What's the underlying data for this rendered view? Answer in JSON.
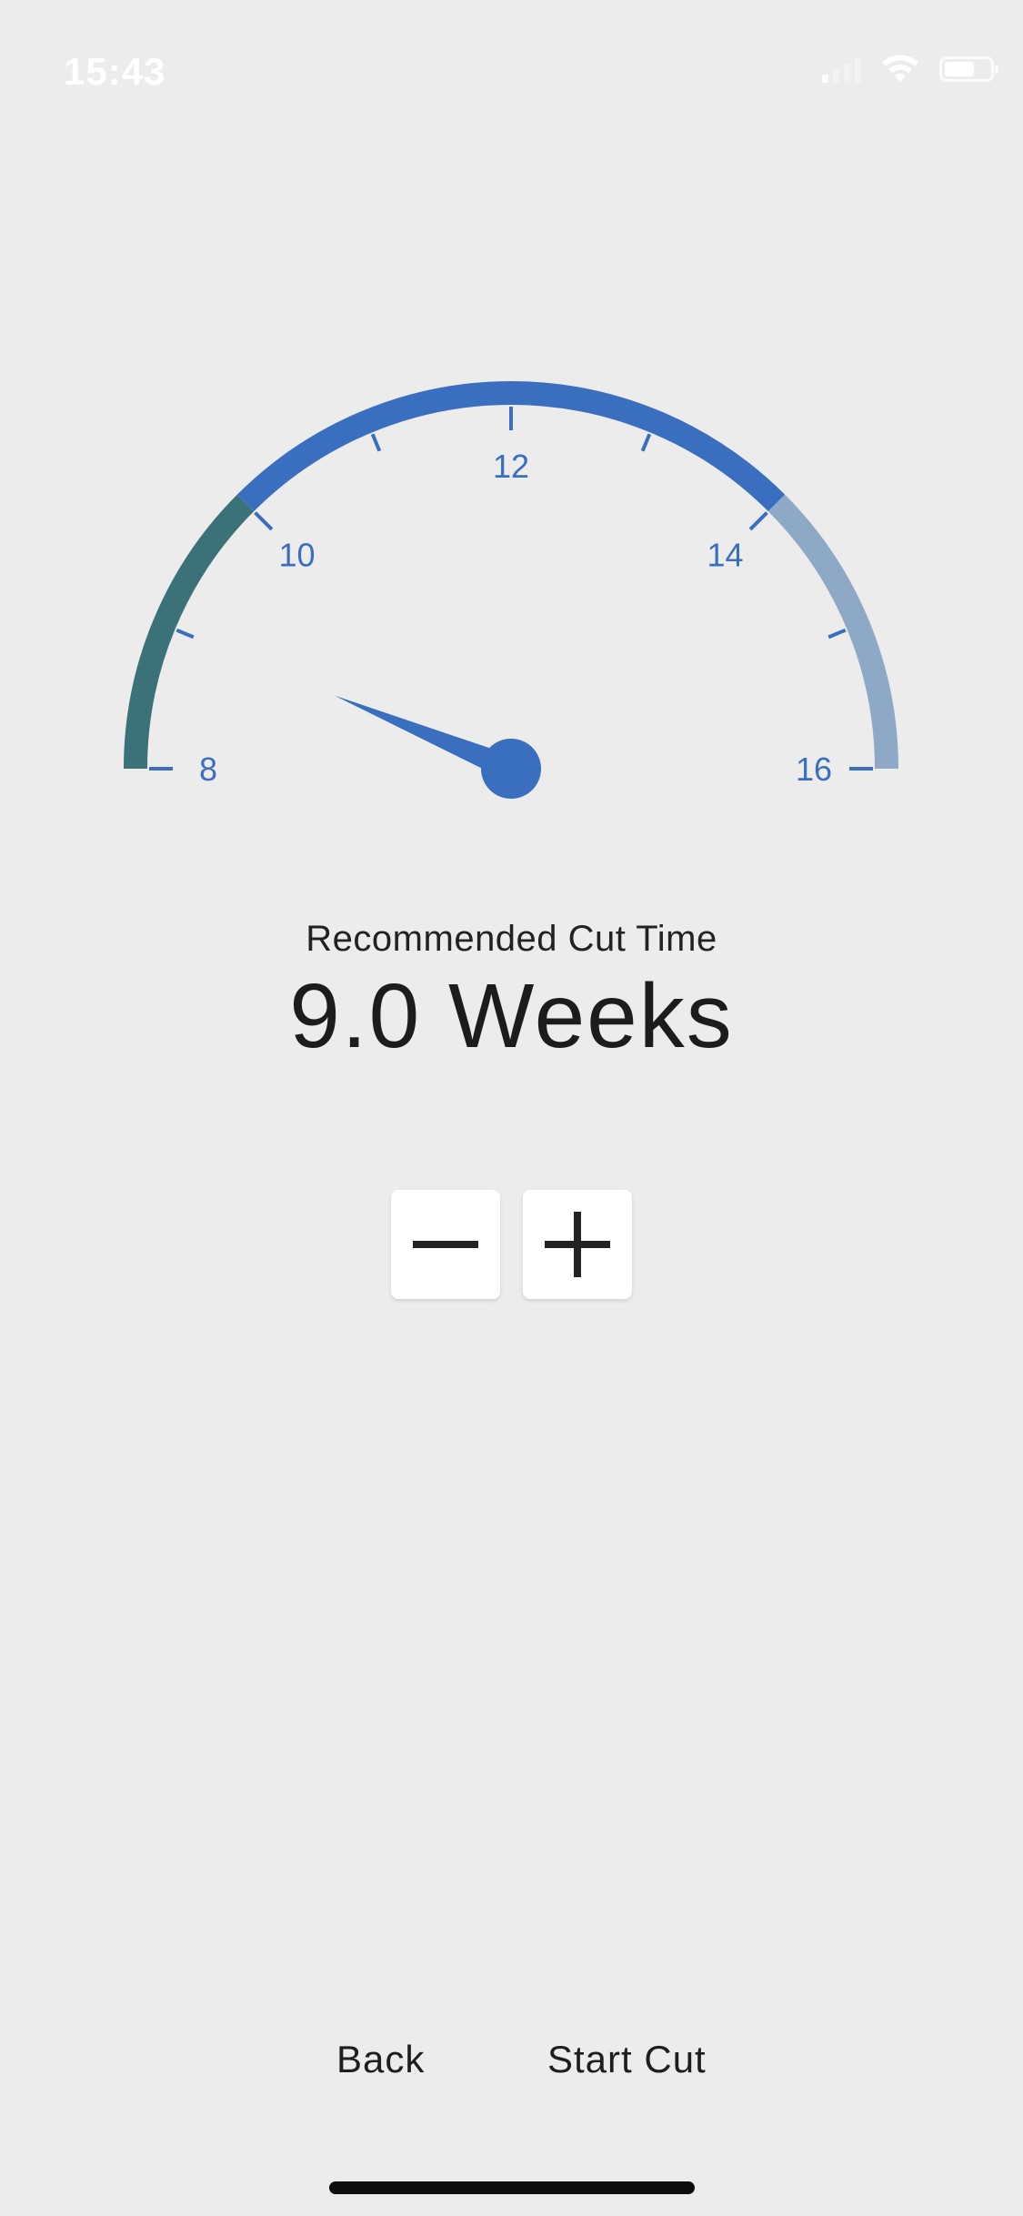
{
  "status_bar": {
    "time": "15:43",
    "icons": [
      "signal-icon",
      "wifi-icon",
      "battery-icon"
    ]
  },
  "gauge": {
    "min": 8,
    "max": 16,
    "value": 9.0,
    "major_ticks": [
      "8",
      "10",
      "12",
      "14",
      "16"
    ],
    "segments": [
      {
        "from": 8,
        "to": 10,
        "color": "#3b7278"
      },
      {
        "from": 10,
        "to": 14,
        "color": "#3a6fc0"
      },
      {
        "from": 14,
        "to": 16,
        "color": "#8ea9c6"
      }
    ],
    "needle_color": "#3a6fc0",
    "label_color": "#3a6fc0"
  },
  "caption": "Recommended Cut Time",
  "value_text": "9.0 Weeks",
  "stepper": {
    "decrement_icon": "minus-icon",
    "increment_icon": "plus-icon"
  },
  "actions": {
    "back": "Back",
    "start": "Start Cut"
  }
}
